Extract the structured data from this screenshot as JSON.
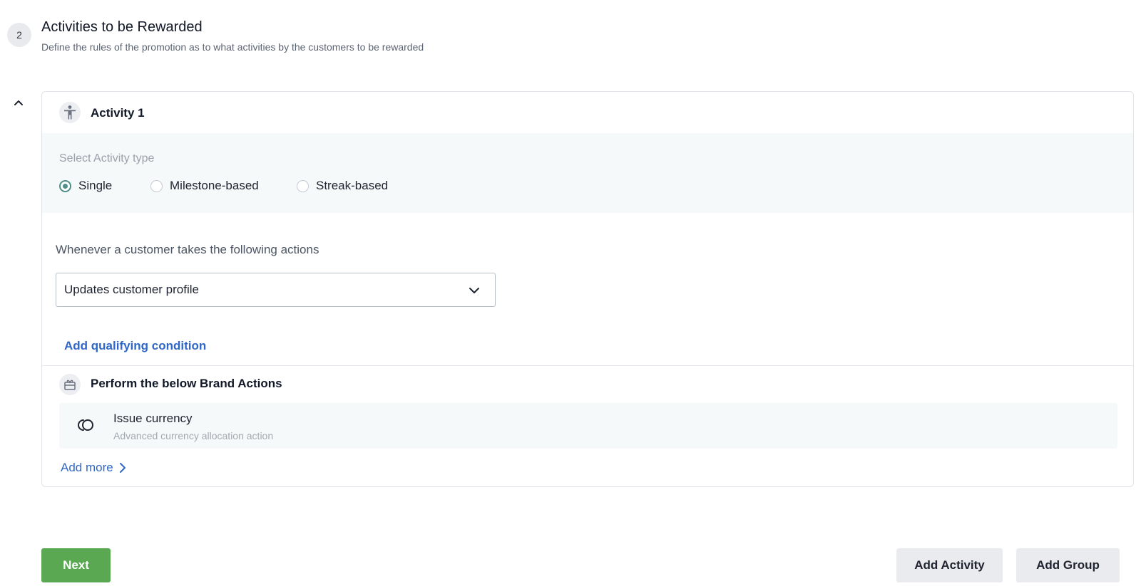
{
  "section": {
    "step_number": "2",
    "title": "Activities to be Rewarded",
    "subtitle": "Define the rules of the promotion as to what activities by the customers to be rewarded"
  },
  "activity": {
    "title": "Activity 1",
    "type_label": "Select Activity type",
    "types": [
      {
        "label": "Single",
        "checked": true
      },
      {
        "label": "Milestone-based",
        "checked": false
      },
      {
        "label": "Streak-based",
        "checked": false
      }
    ],
    "actions_label": "Whenever a customer takes the following actions",
    "selected_action": "Updates customer profile",
    "add_condition_label": "Add qualifying condition"
  },
  "brand_actions": {
    "title": "Perform the below Brand Actions",
    "items": [
      {
        "title": "Issue currency",
        "description": "Advanced currency allocation action",
        "icon": "currency-icon"
      }
    ],
    "add_more_label": "Add more"
  },
  "footer": {
    "next_label": "Next",
    "add_activity_label": "Add Activity",
    "add_group_label": "Add Group"
  },
  "colors": {
    "primary_button": "#5aa851",
    "link": "#2f67c7",
    "radio_checked": "#4e8f8a",
    "panel_background": "#f6f9fa"
  }
}
